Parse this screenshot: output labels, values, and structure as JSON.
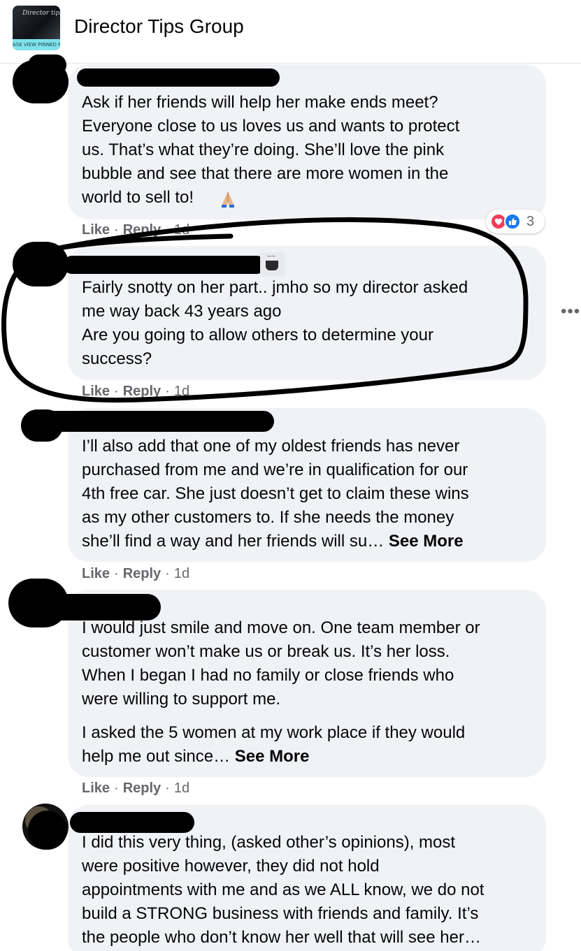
{
  "header": {
    "group_name": "Director Tips Group",
    "thumb_strip_text": "ASE VIEW PINNED P",
    "thumb_script": "Director tips"
  },
  "comments": [
    {
      "lines": [
        "Ask if her friends will help her make ends meet?",
        "Everyone close to us loves us and wants to protect",
        "us. That’s what they’re doing. She’ll love the pink",
        "bubble and see that there are more women in the",
        "world to sell to!"
      ],
      "like": "Like",
      "reply": "Reply",
      "time": "1d",
      "reaction_count": "3"
    },
    {
      "lines": [
        "Fairly snotty on her part.. jmho so my director asked",
        "me way back 43 years ago",
        "Are you going to allow others to determine your",
        "success?"
      ],
      "like": "Like",
      "reply": "Reply",
      "time": "1d"
    },
    {
      "lines": [
        "I’ll also add that one of my oldest friends has never",
        "purchased from me and we’re in qualification for our",
        "4th free car. She just doesn’t get to claim these wins",
        "as my other customers to. If she needs the money",
        "she’ll find a way and her friends will su…"
      ],
      "see_more": "See More",
      "like": "Like",
      "reply": "Reply",
      "time": "1d"
    },
    {
      "lines": [
        "I would just smile and move on. One team member or",
        "customer won’t make us or break us. It’s her loss.",
        "When I began I had no family or close friends who",
        "were willing to support me."
      ],
      "lines2": [
        "I asked the 5 women at my work place if they would",
        "help me out since…"
      ],
      "see_more": "See More",
      "like": "Like",
      "reply": "Reply",
      "time": "1d"
    },
    {
      "lines": [
        "I did this very thing, (asked other’s opinions), most",
        "were positive however, they did not hold",
        "appointments with me and as we ALL know, we do not",
        "build a STRONG business with friends and family. It’s",
        "the people who don’t know her well that will see her…"
      ]
    }
  ],
  "more_options": "•••",
  "colors": {
    "bubble": "#f0f2f5",
    "meta_text": "#65676b",
    "heart": "#f33e58",
    "like_blue": "#1877f2"
  }
}
